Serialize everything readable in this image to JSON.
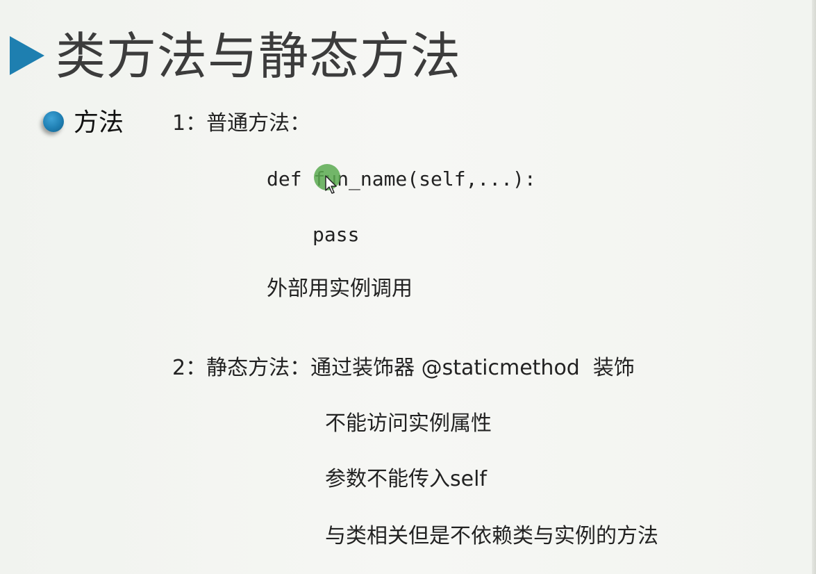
{
  "slide": {
    "title": "类方法与静态方法",
    "bullet_label": "方法",
    "lines": {
      "item1_heading": "1：普通方法：",
      "code_def": "def fun_name(self,...):",
      "code_pass": "pass",
      "item1_note": "外部用实例调用",
      "item2_heading": "2：静态方法：通过装饰器 @staticmethod  装饰",
      "item2_point1": "不能访问实例属性",
      "item2_point2": "参数不能传入self",
      "item2_point3": "与类相关但是不依赖类与实例的方法"
    }
  },
  "colors": {
    "accent": "#1e7fb0",
    "cursor_highlight": "#5aaa50",
    "title_text": "#3c3c3c",
    "background": "#f3f5f1"
  },
  "icons": {
    "title_marker": "triangle-right-icon",
    "bullet": "bullet-dot-icon",
    "cursor": "mouse-cursor-icon"
  }
}
